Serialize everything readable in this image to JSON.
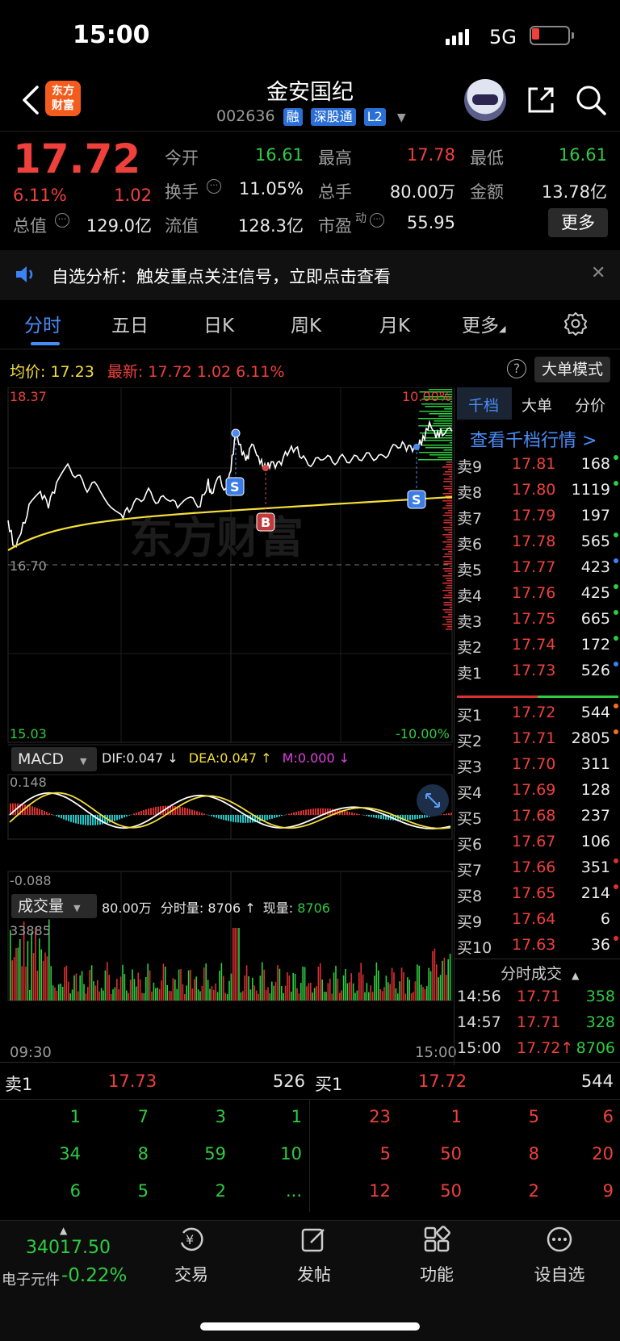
{
  "status_bar": {
    "time": "15:00",
    "network": "5G"
  },
  "header": {
    "logo_text": "东方\n财富",
    "stock_name": "金安国纪",
    "stock_code": "002636",
    "tags": [
      "融",
      "深股通",
      "L2"
    ]
  },
  "quote": {
    "price": "17.72",
    "change_pct": "6.11%",
    "change": "1.02",
    "open_label": "今开",
    "open": "16.61",
    "high_label": "最高",
    "high": "17.78",
    "low_label": "最低",
    "low": "16.61",
    "turnover_label": "换手",
    "turnover": "11.05%",
    "volume_label": "总手",
    "volume": "80.00万",
    "amount_label": "金额",
    "amount": "13.78亿",
    "mktcap_label": "总值",
    "mktcap": "129.0亿",
    "float_label": "流值",
    "float_cap": "128.3亿",
    "pe_label": "市盈",
    "pe_sup": "动",
    "pe": "55.95",
    "more_label": "更多"
  },
  "notice": {
    "text": "自选分析：触发重点关注信号，立即点击查看"
  },
  "tabs": [
    {
      "label": "分时",
      "active": true
    },
    {
      "label": "五日"
    },
    {
      "label": "日K"
    },
    {
      "label": "周K"
    },
    {
      "label": "月K"
    },
    {
      "label": "更多"
    }
  ],
  "chart_info": {
    "avg_label": "均价:",
    "avg": "17.23",
    "latest_label": "最新:",
    "latest": "17.72",
    "latest_chg": "1.02",
    "latest_pct": "6.11%",
    "big_order_mode": "大单模式",
    "price_max": "18.37",
    "price_min": "15.03",
    "price_ref": "16.70",
    "pct_max": "10.00%",
    "pct_min": "-10.00%",
    "watermark": "东方财富",
    "macd_label": "MACD",
    "dif": "DIF:0.047 ↓",
    "dea": "DEA:0.047 ↑",
    "m": "M:0.000 ↓",
    "macd_max": "0.148",
    "macd_min": "-0.088",
    "vol_label": "成交量",
    "vol_total": "80.00万",
    "vol_bar_label": "分时量:",
    "vol_bar": "8706 ↑",
    "vol_now_label": "现量:",
    "vol_now": "8706",
    "vol_max": "33885",
    "time_start": "09:30",
    "time_end": "15:00",
    "markers": [
      "S",
      "B",
      "S"
    ]
  },
  "depth_panel": {
    "tabs": [
      "千档",
      "大单",
      "分价"
    ],
    "link": "查看千档行情 >",
    "asks": [
      {
        "label": "卖9",
        "price": "17.81",
        "qty": "168"
      },
      {
        "label": "卖8",
        "price": "17.80",
        "qty": "1119"
      },
      {
        "label": "卖7",
        "price": "17.79",
        "qty": "197"
      },
      {
        "label": "卖6",
        "price": "17.78",
        "qty": "565"
      },
      {
        "label": "卖5",
        "price": "17.77",
        "qty": "423"
      },
      {
        "label": "卖4",
        "price": "17.76",
        "qty": "425"
      },
      {
        "label": "卖3",
        "price": "17.75",
        "qty": "665"
      },
      {
        "label": "卖2",
        "price": "17.74",
        "qty": "172"
      },
      {
        "label": "卖1",
        "price": "17.73",
        "qty": "526"
      }
    ],
    "bids": [
      {
        "label": "买1",
        "price": "17.72",
        "qty": "544"
      },
      {
        "label": "买2",
        "price": "17.71",
        "qty": "2805"
      },
      {
        "label": "买3",
        "price": "17.70",
        "qty": "311"
      },
      {
        "label": "买4",
        "price": "17.69",
        "qty": "128"
      },
      {
        "label": "买5",
        "price": "17.68",
        "qty": "237"
      },
      {
        "label": "买6",
        "price": "17.67",
        "qty": "106"
      },
      {
        "label": "买7",
        "price": "17.66",
        "qty": "351"
      },
      {
        "label": "买8",
        "price": "17.65",
        "qty": "214"
      },
      {
        "label": "买9",
        "price": "17.64",
        "qty": "6"
      },
      {
        "label": "买10",
        "price": "17.63",
        "qty": "36"
      }
    ],
    "ticks_title": "分时成交",
    "ticks": [
      {
        "time": "14:56",
        "price": "17.71",
        "qty": "358"
      },
      {
        "time": "14:57",
        "price": "17.71",
        "qty": "328"
      },
      {
        "time": "15:00",
        "price": "17.72↑",
        "qty": "8706"
      }
    ]
  },
  "queue": {
    "sell_label": "卖1",
    "sell_price": "17.73",
    "sell_qty": "526",
    "buy_label": "买1",
    "buy_price": "17.72",
    "buy_qty": "544",
    "sell_rows": [
      [
        "1",
        "7",
        "3",
        "1"
      ],
      [
        "34",
        "8",
        "59",
        "10"
      ],
      [
        "6",
        "5",
        "2",
        "..."
      ]
    ],
    "buy_rows": [
      [
        "23",
        "1",
        "5",
        "6"
      ],
      [
        "5",
        "50",
        "8",
        "20"
      ],
      [
        "12",
        "50",
        "2",
        "9"
      ]
    ]
  },
  "bottom_nav": {
    "index_value": "34017.50",
    "index_name": "电子元件",
    "index_pct": "-0.22%",
    "items": [
      "交易",
      "发帖",
      "功能",
      "设自选"
    ]
  }
}
